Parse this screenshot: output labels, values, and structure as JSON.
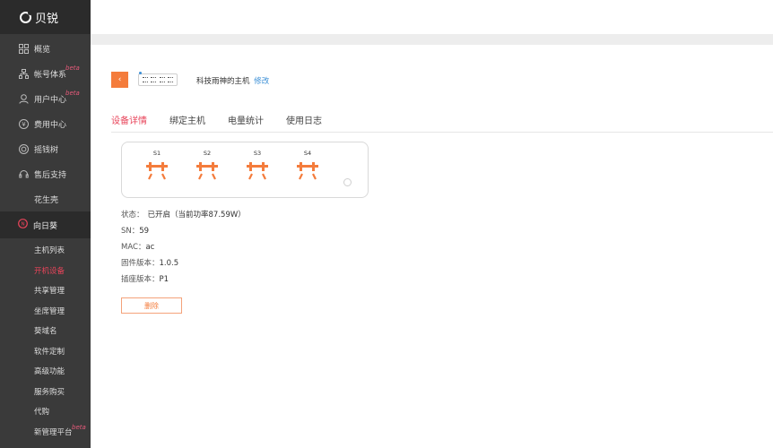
{
  "brand": {
    "name": "贝锐"
  },
  "nav": {
    "items": [
      {
        "label": "概览",
        "icon": "grid-icon",
        "beta": ""
      },
      {
        "label": "帐号体系",
        "icon": "org-icon",
        "beta": "beta"
      },
      {
        "label": "用户中心",
        "icon": "user-icon",
        "beta": "beta"
      },
      {
        "label": "费用中心",
        "icon": "yen-icon",
        "beta": ""
      },
      {
        "label": "摇钱树",
        "icon": "target-icon",
        "beta": ""
      },
      {
        "label": "售后支持",
        "icon": "headset-icon",
        "beta": ""
      }
    ],
    "huasheng": "花生壳",
    "section": {
      "label": "向日葵",
      "icon": "sunflower-icon"
    },
    "sub_items": [
      {
        "label": "主机列表",
        "beta": ""
      },
      {
        "label": "开机设备",
        "beta": ""
      },
      {
        "label": "共享管理",
        "beta": ""
      },
      {
        "label": "坐席管理",
        "beta": ""
      },
      {
        "label": "葵域名",
        "beta": ""
      },
      {
        "label": "软件定制",
        "beta": ""
      },
      {
        "label": "高级功能",
        "beta": ""
      },
      {
        "label": "服务购买",
        "beta": ""
      },
      {
        "label": "代购",
        "beta": ""
      },
      {
        "label": "新管理平台",
        "beta": "beta"
      }
    ],
    "active_sub": "开机设备"
  },
  "header": {
    "title": "科技雨神的主机",
    "edit_label": "修改"
  },
  "tabs": [
    "设备详情",
    "绑定主机",
    "电量统计",
    "使用日志"
  ],
  "active_tab": "设备详情",
  "sockets": [
    {
      "label": "S1"
    },
    {
      "label": "S2"
    },
    {
      "label": "S3"
    },
    {
      "label": "S4"
    }
  ],
  "details": {
    "status_label": "状态：",
    "status_value": "已开启（当前功率87.59W）",
    "sn_label": "SN：",
    "sn_value": "59",
    "mac_label": "MAC：",
    "mac_value": "ac",
    "firmware_label": "固件版本：",
    "firmware_value": "1.0.5",
    "strip_label": "插座版本：",
    "strip_value": "P1"
  },
  "delete_label": "删除",
  "colors": {
    "accent": "#f47c3c",
    "active": "#e8445a",
    "link": "#3b8fd6",
    "sidebar": "#3a3a3a"
  }
}
